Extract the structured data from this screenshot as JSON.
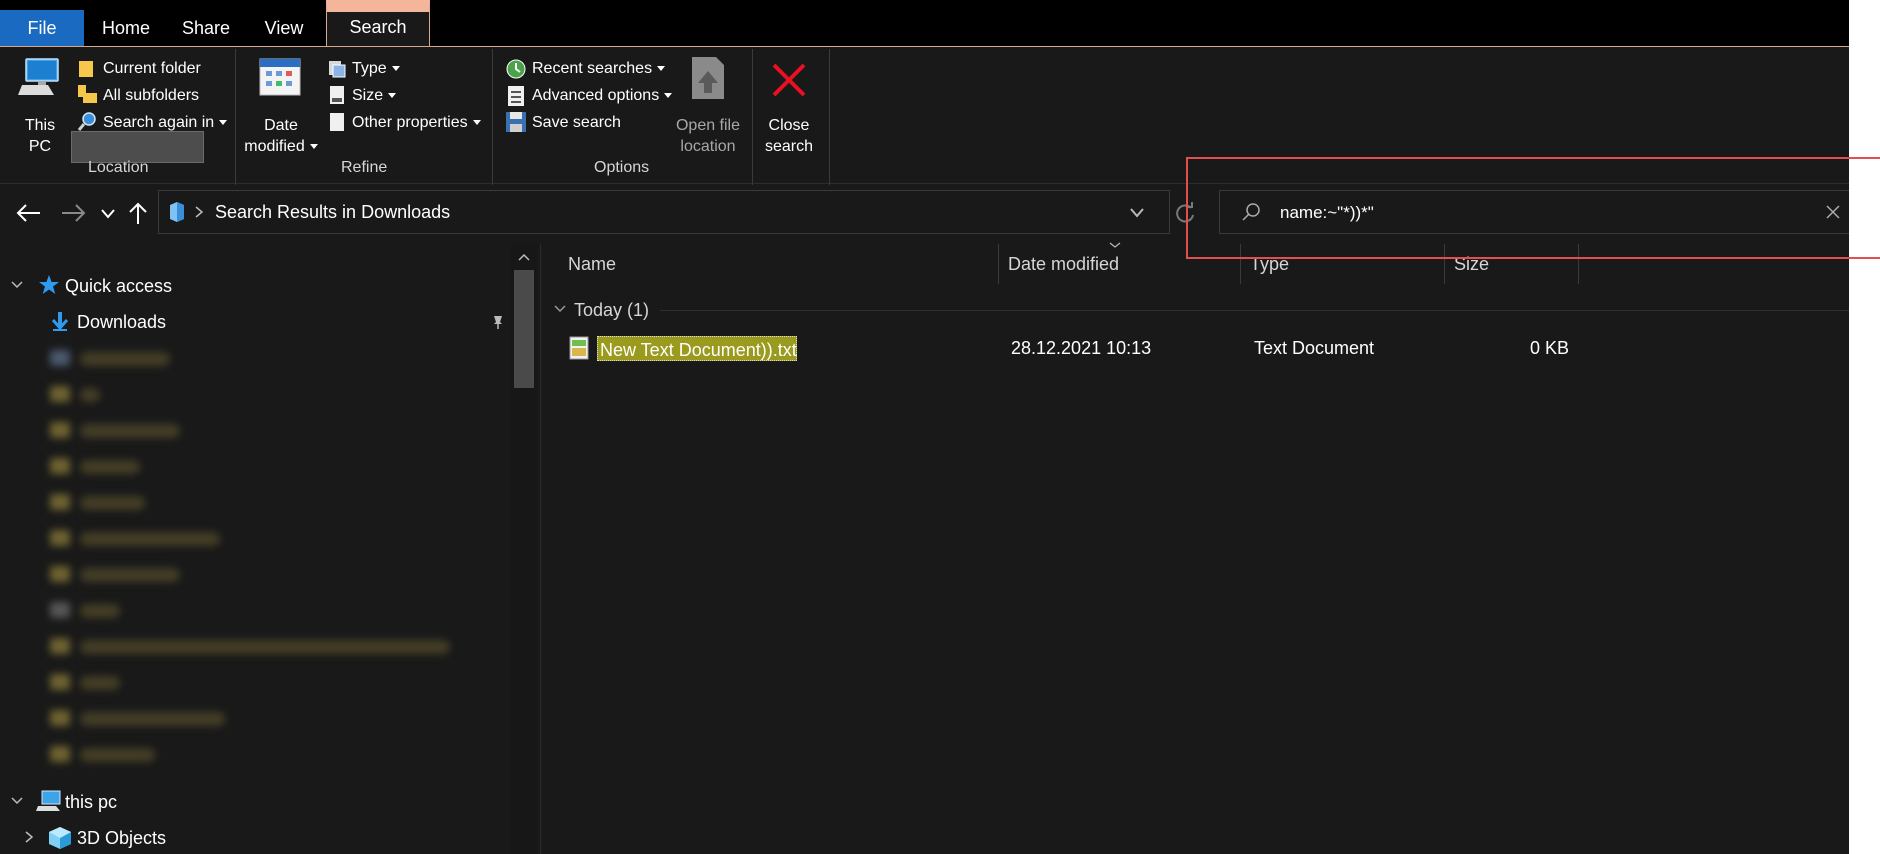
{
  "tabs": {
    "file": "File",
    "home": "Home",
    "share": "Share",
    "view": "View",
    "search": "Search"
  },
  "ribbon": {
    "location": {
      "this_pc_line1": "This",
      "this_pc_line2": "PC",
      "current_folder": "Current folder",
      "all_subfolders": "All subfolders",
      "search_again_in": "Search again in",
      "label": "Location"
    },
    "refine": {
      "date_modified_line1": "Date",
      "date_modified_line2": "modified",
      "type": "Type",
      "size": "Size",
      "other_properties": "Other properties",
      "label": "Refine"
    },
    "options": {
      "recent_searches": "Recent searches",
      "advanced_options": "Advanced options",
      "save_search": "Save search",
      "open_file_location_line1": "Open file",
      "open_file_location_line2": "location",
      "label": "Options"
    },
    "close": {
      "line1": "Close",
      "line2": "search"
    }
  },
  "address": {
    "path": "Search Results in Downloads"
  },
  "search": {
    "query": "name:~\"*))*\""
  },
  "nav": {
    "quick_access": "Quick access",
    "downloads": "Downloads",
    "this_pc": "this pc",
    "objects_3d": "3D Objects"
  },
  "columns": {
    "name": "Name",
    "date_modified": "Date modified",
    "type": "Type",
    "size": "Size"
  },
  "group": {
    "label": "Today (1)"
  },
  "files": [
    {
      "name": "New Text Document)).txt",
      "date": "28.12.2021 10:13",
      "type": "Text Document",
      "size": "0 KB"
    }
  ],
  "colors": {
    "accent": "#1a6ac1",
    "highlight": "#9a9a1e",
    "close_red": "#e81123",
    "annotation_red": "#e05050"
  }
}
